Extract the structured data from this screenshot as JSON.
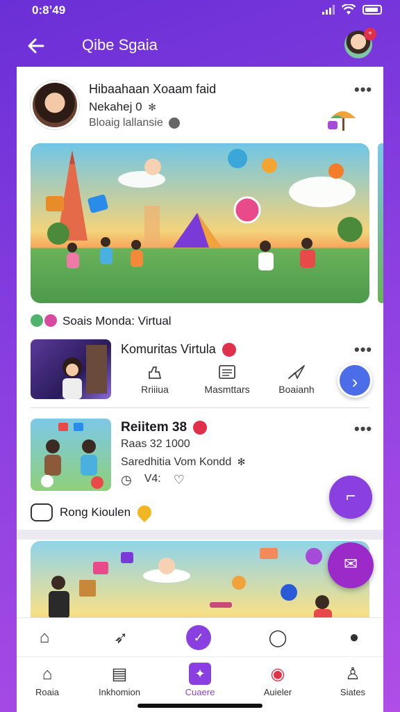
{
  "status": {
    "time": "0:8ʼ49"
  },
  "header": {
    "title": "Qibe Sgaia",
    "badge": "+"
  },
  "profile": {
    "name": "Hibaahaan Xoaam faid",
    "subtitle": "Nekahej 0",
    "meta": "Bloaig lallansie"
  },
  "section": {
    "title": "Soais Monda: Virtual"
  },
  "card1": {
    "title": "Komuritas Virtula",
    "actions": [
      {
        "label": "Rriiiua",
        "icon": "like-icon"
      },
      {
        "label": "Masmttars",
        "icon": "comment-icon"
      },
      {
        "label": "Boaianh",
        "icon": "share-icon"
      }
    ]
  },
  "card2": {
    "title": "Reiitem 38",
    "subtitle": "Raas 32 1000",
    "meta": "Saredhitia Vom Kondd",
    "counter": "V4:"
  },
  "ring": {
    "label": "Rong Kioulen"
  },
  "bottom_icons": [
    "home-icon",
    "compass-icon",
    "check-circle-icon",
    "chat-icon",
    "profile-icon"
  ],
  "tabs": [
    {
      "label": "Roaia",
      "icon": "home-icon"
    },
    {
      "label": "Inkhomion",
      "icon": "document-icon"
    },
    {
      "label": "Cuaere",
      "icon": "create-icon"
    },
    {
      "label": "Auieler",
      "icon": "notification-icon"
    },
    {
      "label": "Siates",
      "icon": "person-icon"
    }
  ],
  "colors": {
    "accent": "#8a3fe0",
    "blue": "#4b6ee8",
    "badge": "#e0314a"
  }
}
